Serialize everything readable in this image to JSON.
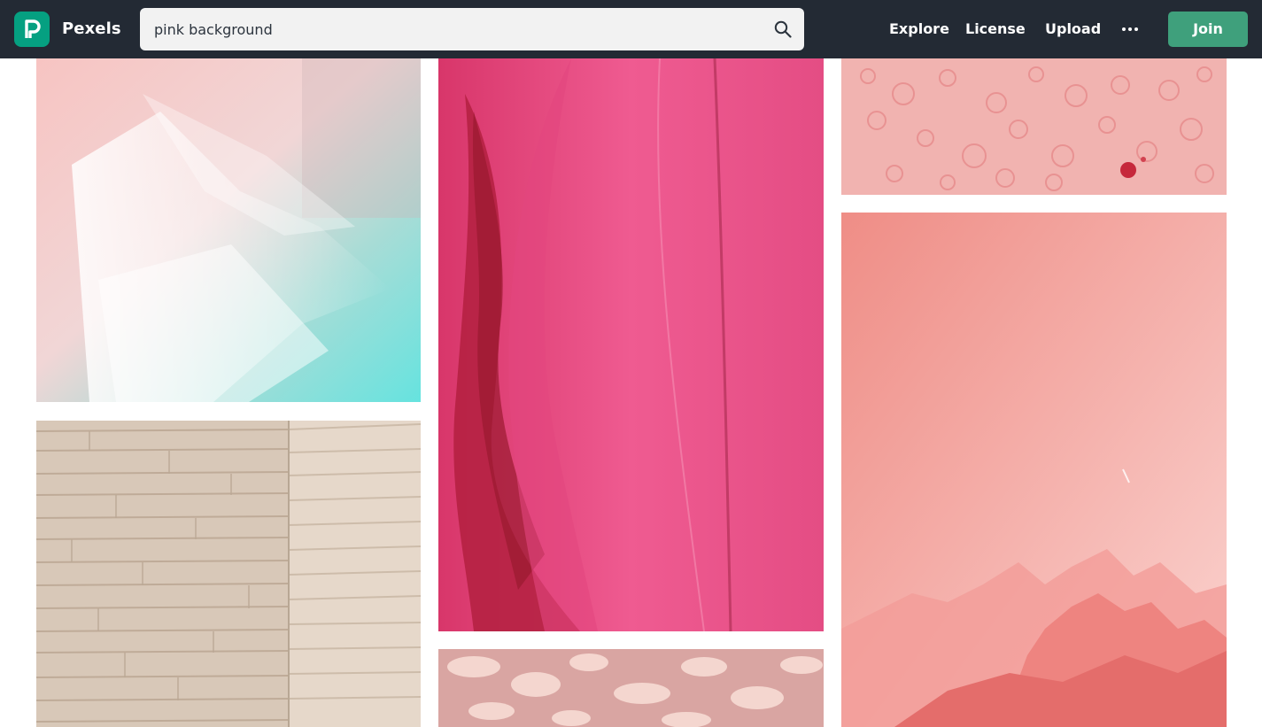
{
  "header": {
    "logo_icon": "pexels-logo-icon",
    "brand": "Pexels",
    "search": {
      "value": "pink background",
      "icon": "search-icon"
    },
    "nav": [
      {
        "label": "Explore"
      },
      {
        "label": "License"
      },
      {
        "label": "Upload"
      }
    ],
    "more_icon": "more-horizontal-icon",
    "join_label": "Join"
  },
  "photos": [
    {
      "subject": "pink and turquoise smoke texture"
    },
    {
      "subject": "beige stone brick wall"
    },
    {
      "subject": "pink leaf close-up"
    },
    {
      "subject": "shadow pattern on pink surface"
    },
    {
      "subject": "pink bubbles texture"
    },
    {
      "subject": "pink sky over mountains"
    }
  ],
  "colors": {
    "header_bg": "#232a34",
    "brand_green": "#05a081",
    "join_button": "#3fa07c",
    "search_bg": "#f2f2f2"
  }
}
